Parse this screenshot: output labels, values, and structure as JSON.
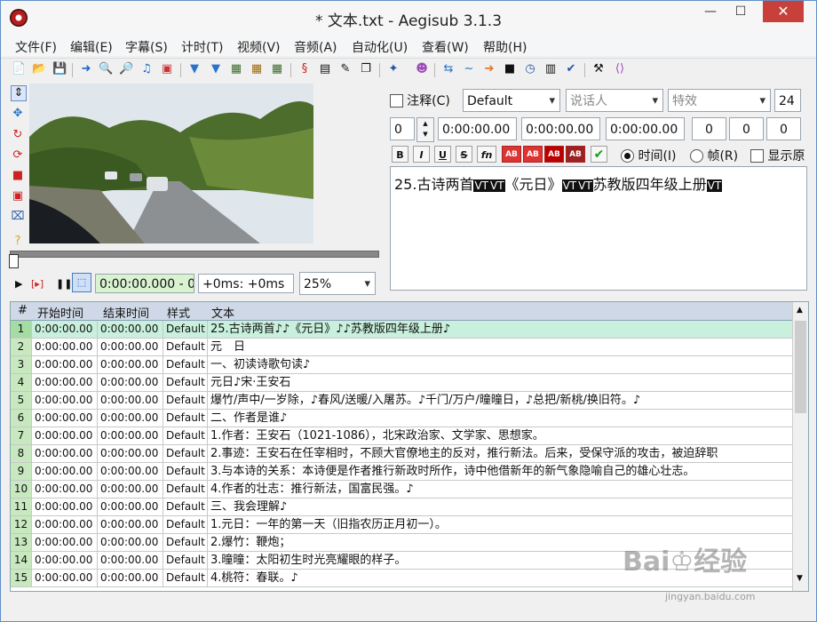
{
  "window": {
    "title": "* 文本.txt - Aegisub 3.1.3",
    "minimize": "—",
    "maximize": "☐",
    "close": "✕"
  },
  "menu": [
    "文件(F)",
    "编辑(E)",
    "字幕(S)",
    "计时(T)",
    "视频(V)",
    "音频(A)",
    "自动化(U)",
    "查看(W)",
    "帮助(H)"
  ],
  "toolbar_icons": [
    "new-file-icon",
    "open-file-icon",
    "save-icon",
    "jump-to-icon",
    "zoom-in-icon",
    "zoom-out-icon",
    "audio-icon",
    "video-icon",
    "style-manager-icon",
    "attach-icon",
    "keyframes-icon",
    "film-icon",
    "timecode-icon",
    "script-icon",
    "properties-icon",
    "resample-icon",
    "translate-icon",
    "spellcheck-icon",
    "fonts-icon",
    "kanji-icon",
    "shift-times-icon",
    "timing-icon",
    "automation-icon",
    "stop-icon",
    "clock-icon",
    "options-icon",
    "check-icon",
    "tools-icon",
    "tag-icon"
  ],
  "video_tools": [
    "drag-subtitle-icon",
    "move-icon",
    "rotate-z-icon",
    "rotate-xy-icon",
    "scale-icon",
    "clip-rect-icon",
    "clip-vector-icon",
    "help-icon"
  ],
  "playback": {
    "time": "0:00:00.000 - 0",
    "offset": "+0ms: +0ms",
    "zoom": "25%"
  },
  "edit": {
    "comment_label": "注释(C)",
    "style": "Default",
    "actor_placeholder": "说话人",
    "effect_placeholder": "特效",
    "layer_size": "24",
    "layer": "0",
    "start": "0:00:00.00",
    "end": "0:00:00.00",
    "duration": "0:00:00.00",
    "margin_l": "0",
    "margin_r": "0",
    "margin_v": "0",
    "fmt_bold": "B",
    "fmt_italic": "I",
    "fmt_underline": "U",
    "fmt_strike": "S",
    "fmt_font": "fn",
    "fmt_color": "AB",
    "time_label": "时间(I)",
    "frame_label": "帧(R)",
    "show_label": "显示原",
    "text_parts": [
      "25.古诗两首",
      "VT",
      "VT",
      "《元日》",
      "VT",
      "VT",
      "苏教版四年级上册",
      "VT"
    ]
  },
  "grid": {
    "headers": {
      "num": "#",
      "start": "开始时间",
      "end": "结束时间",
      "style": "样式",
      "text": "文本"
    },
    "rows": [
      {
        "num": "1",
        "start": "0:00:00.00",
        "end": "0:00:00.00",
        "style": "Default",
        "text": "25.古诗两首♪♪《元日》♪♪苏教版四年级上册♪"
      },
      {
        "num": "2",
        "start": "0:00:00.00",
        "end": "0:00:00.00",
        "style": "Default",
        "text": "元　日"
      },
      {
        "num": "3",
        "start": "0:00:00.00",
        "end": "0:00:00.00",
        "style": "Default",
        "text": "一、初读诗歌句读♪"
      },
      {
        "num": "4",
        "start": "0:00:00.00",
        "end": "0:00:00.00",
        "style": "Default",
        "text": "元日♪宋·王安石"
      },
      {
        "num": "5",
        "start": "0:00:00.00",
        "end": "0:00:00.00",
        "style": "Default",
        "text": "爆竹/声中/一岁除，♪春风/送暖/入屠苏。♪千门/万户/曈曈日，♪总把/新桃/换旧符。♪"
      },
      {
        "num": "6",
        "start": "0:00:00.00",
        "end": "0:00:00.00",
        "style": "Default",
        "text": "二、作者是谁♪"
      },
      {
        "num": "7",
        "start": "0:00:00.00",
        "end": "0:00:00.00",
        "style": "Default",
        "text": "1.作者：王安石（1021-1086），北宋政治家、文学家、思想家。"
      },
      {
        "num": "8",
        "start": "0:00:00.00",
        "end": "0:00:00.00",
        "style": "Default",
        "text": "2.事迹：王安石在任宰相时，不顾大官僚地主的反对，推行新法。后来，受保守派的攻击，被迫辞职"
      },
      {
        "num": "9",
        "start": "0:00:00.00",
        "end": "0:00:00.00",
        "style": "Default",
        "text": "3.与本诗的关系：本诗便是作者推行新政时所作，诗中他借新年的新气象隐喻自己的雄心壮志。"
      },
      {
        "num": "10",
        "start": "0:00:00.00",
        "end": "0:00:00.00",
        "style": "Default",
        "text": "4.作者的壮志：推行新法，国富民强。♪"
      },
      {
        "num": "11",
        "start": "0:00:00.00",
        "end": "0:00:00.00",
        "style": "Default",
        "text": "三、我会理解♪"
      },
      {
        "num": "12",
        "start": "0:00:00.00",
        "end": "0:00:00.00",
        "style": "Default",
        "text": "1.元日：一年的第一天（旧指农历正月初一）。"
      },
      {
        "num": "13",
        "start": "0:00:00.00",
        "end": "0:00:00.00",
        "style": "Default",
        "text": "2.爆竹：鞭炮；"
      },
      {
        "num": "14",
        "start": "0:00:00.00",
        "end": "0:00:00.00",
        "style": "Default",
        "text": "3.曈曈：太阳初生时光亮耀眼的样子。"
      },
      {
        "num": "15",
        "start": "0:00:00.00",
        "end": "0:00:00.00",
        "style": "Default",
        "text": "4.桃符：春联。♪"
      }
    ]
  },
  "watermark": {
    "main": "Bai♔经验",
    "sub": "jingyan.baidu.com"
  }
}
